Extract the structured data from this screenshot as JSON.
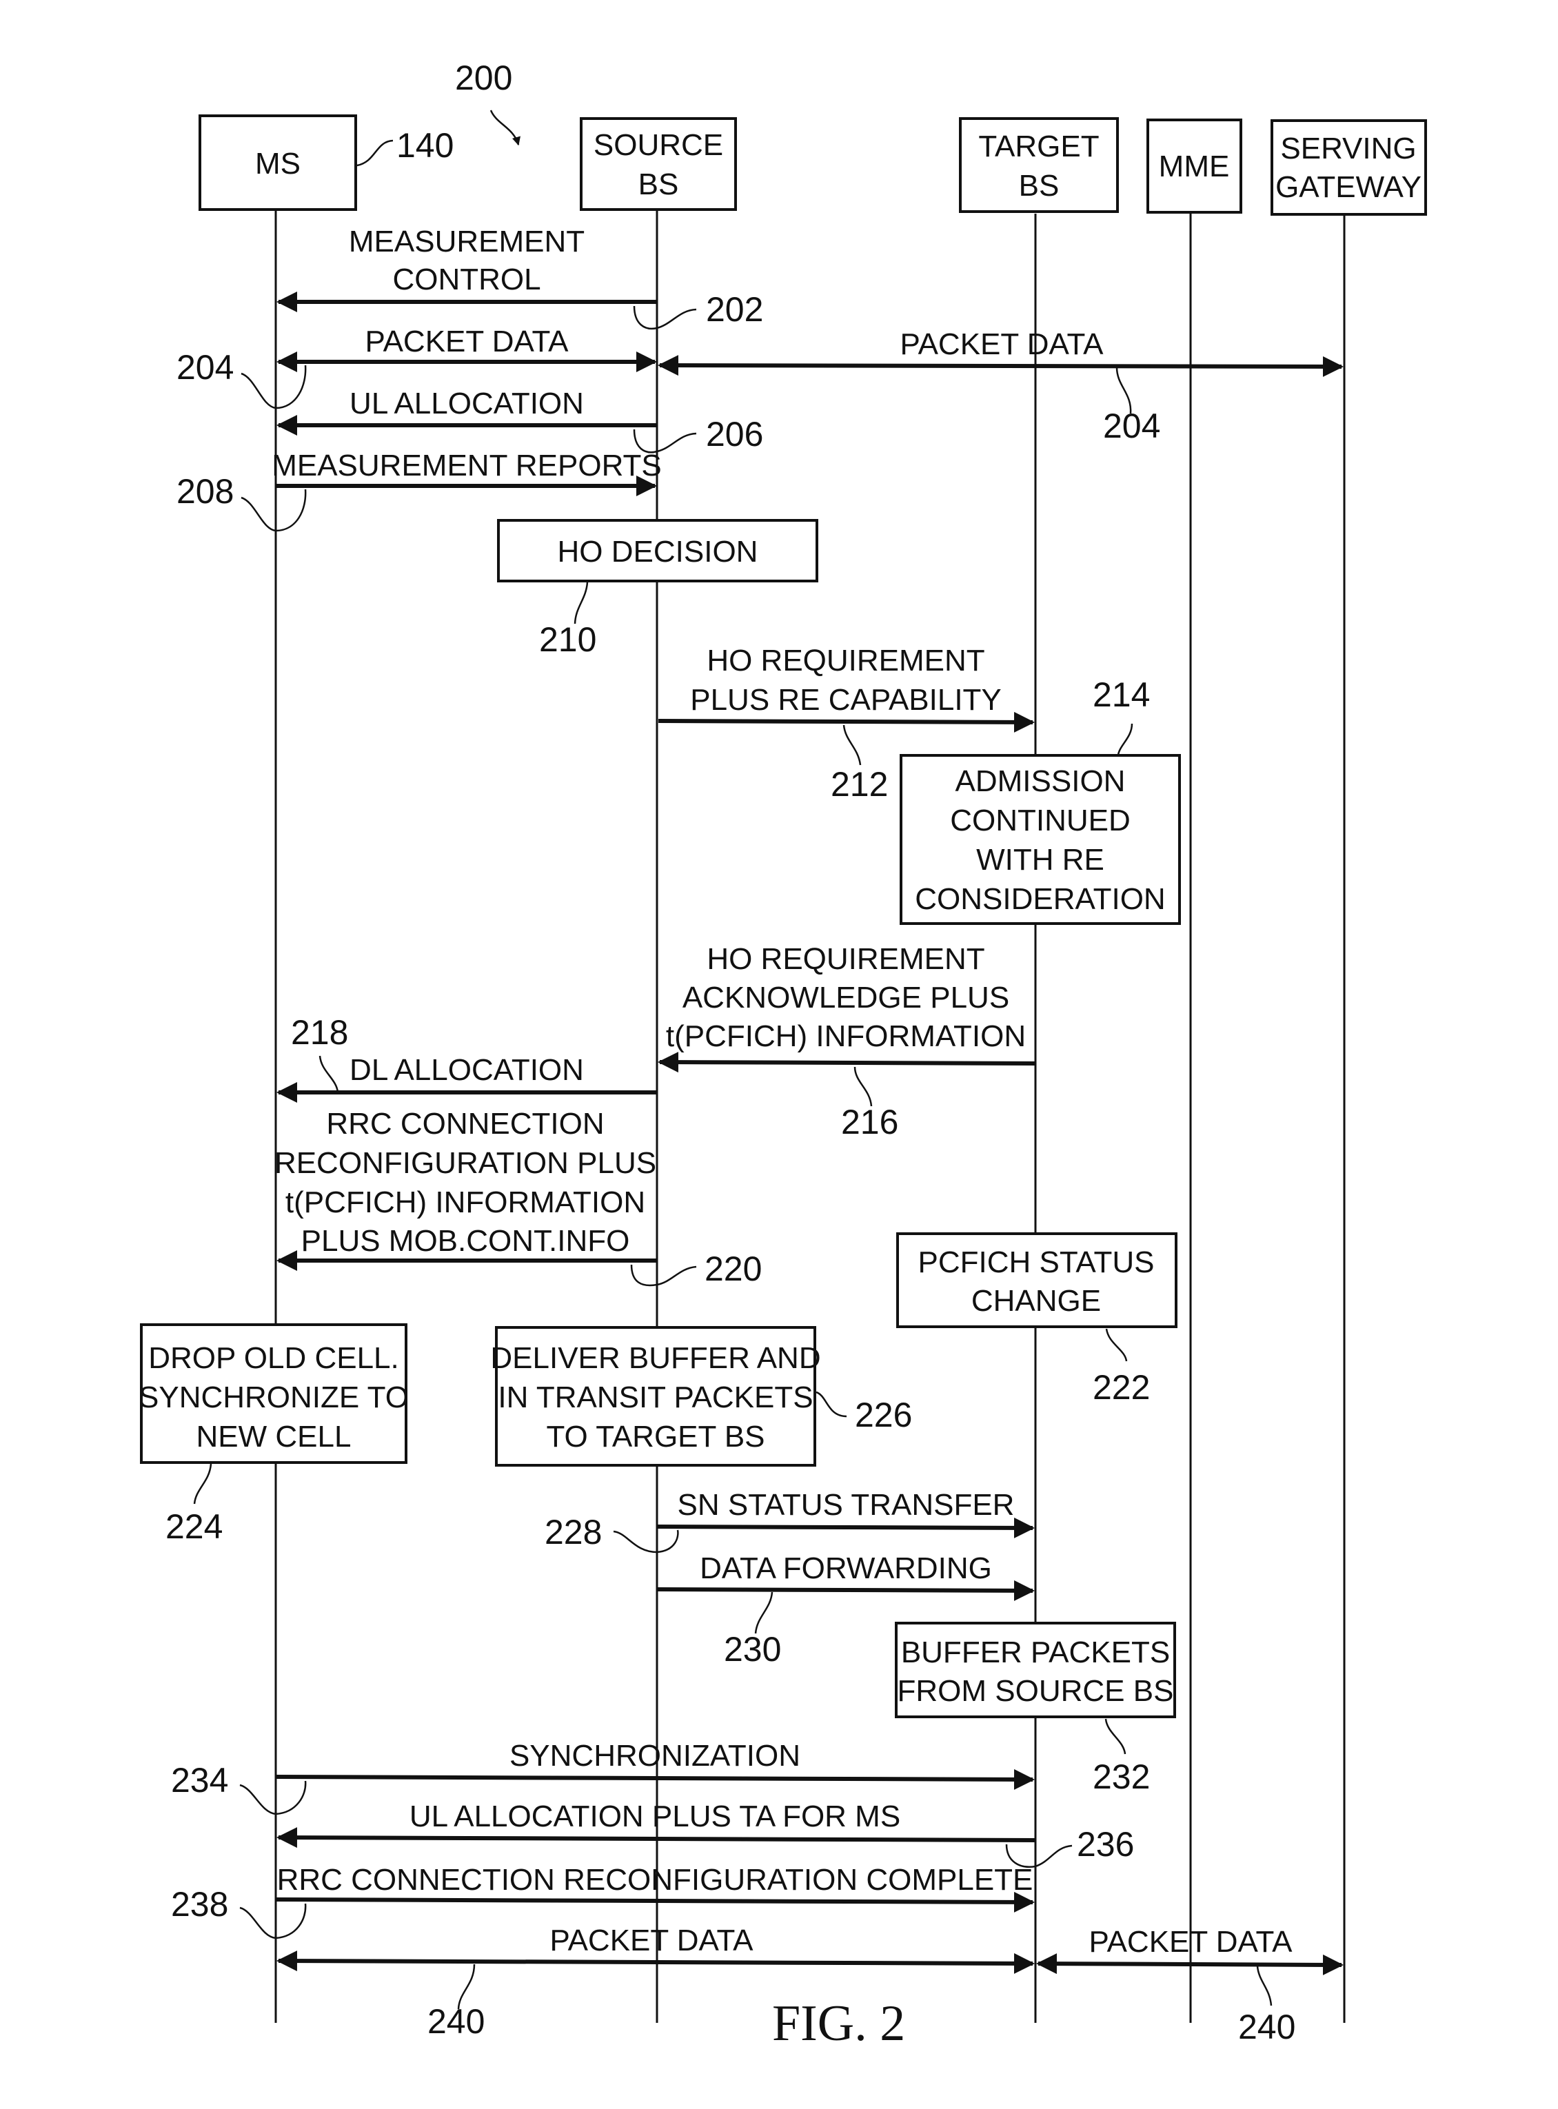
{
  "figure": {
    "ref": "200",
    "caption": "FIG. 2"
  },
  "entities": [
    {
      "id": "ms",
      "lines": [
        "MS"
      ],
      "ref": "140"
    },
    {
      "id": "source",
      "lines": [
        "SOURCE",
        "BS"
      ]
    },
    {
      "id": "target",
      "lines": [
        "TARGET",
        "BS"
      ]
    },
    {
      "id": "mme",
      "lines": [
        "MME"
      ]
    },
    {
      "id": "gateway",
      "lines": [
        "SERVING",
        "GATEWAY"
      ]
    }
  ],
  "messages": [
    {
      "id": "m202",
      "from": "source",
      "to": "ms",
      "lines": [
        "MEASUREMENT",
        "CONTROL"
      ],
      "ref": "202"
    },
    {
      "id": "m204a",
      "from": "ms",
      "to": "source",
      "bidir": true,
      "lines": [
        "PACKET DATA"
      ],
      "ref": "204"
    },
    {
      "id": "m204b",
      "from": "source",
      "to": "gateway",
      "bidir": true,
      "lines": [
        "PACKET DATA"
      ],
      "ref": "204"
    },
    {
      "id": "m206",
      "from": "source",
      "to": "ms",
      "lines": [
        "UL ALLOCATION"
      ],
      "ref": "206"
    },
    {
      "id": "m208",
      "from": "ms",
      "to": "source",
      "lines": [
        "MEASUREMENT REPORTS"
      ],
      "ref": "208"
    },
    {
      "id": "m212",
      "from": "source",
      "to": "target",
      "lines": [
        "HO REQUIREMENT",
        "PLUS RE CAPABILITY"
      ],
      "ref": "212"
    },
    {
      "id": "m216",
      "from": "target",
      "to": "source",
      "lines": [
        "HO REQUIREMENT",
        "ACKNOWLEDGE PLUS",
        "t(PCFICH) INFORMATION"
      ],
      "ref": "216"
    },
    {
      "id": "m218",
      "from": "source",
      "to": "ms",
      "lines": [
        "DL ALLOCATION"
      ],
      "ref": "218"
    },
    {
      "id": "m220",
      "from": "source",
      "to": "ms",
      "lines": [
        "RRC CONNECTION",
        "RECONFIGURATION PLUS",
        "t(PCFICH) INFORMATION",
        "PLUS MOB.CONT.INFO"
      ],
      "ref": "220"
    },
    {
      "id": "m228",
      "from": "source",
      "to": "target",
      "lines": [
        "SN STATUS TRANSFER"
      ],
      "ref": "228"
    },
    {
      "id": "m230",
      "from": "source",
      "to": "target",
      "lines": [
        "DATA FORWARDING"
      ],
      "ref": "230"
    },
    {
      "id": "m234",
      "from": "ms",
      "to": "target",
      "lines": [
        "SYNCHRONIZATION"
      ],
      "ref": "234"
    },
    {
      "id": "m236",
      "from": "target",
      "to": "ms",
      "lines": [
        "UL ALLOCATION PLUS TA FOR MS"
      ],
      "ref": "236"
    },
    {
      "id": "m238",
      "from": "ms",
      "to": "target",
      "lines": [
        "RRC CONNECTION RECONFIGURATION COMPLETE"
      ],
      "ref": "238"
    },
    {
      "id": "m240a",
      "from": "ms",
      "to": "target",
      "bidir": true,
      "lines": [
        "PACKET DATA"
      ],
      "ref": "240"
    },
    {
      "id": "m240b",
      "from": "target",
      "to": "gateway",
      "bidir": true,
      "lines": [
        "PACKET DATA"
      ],
      "ref": "240"
    }
  ],
  "actions": [
    {
      "id": "a210",
      "lines": [
        "HO DECISION"
      ],
      "ref": "210"
    },
    {
      "id": "a214",
      "lines": [
        "ADMISSION",
        "CONTINUED",
        "WITH RE",
        "CONSIDERATION"
      ],
      "ref": "214"
    },
    {
      "id": "a222",
      "lines": [
        "PCFICH STATUS",
        "CHANGE"
      ],
      "ref": "222"
    },
    {
      "id": "a224",
      "lines": [
        "DROP OLD CELL.",
        "SYNCHRONIZE TO",
        "NEW CELL"
      ],
      "ref": "224"
    },
    {
      "id": "a226",
      "lines": [
        "DELIVER BUFFER AND",
        "IN TRANSIT PACKETS",
        "TO TARGET BS"
      ],
      "ref": "226"
    },
    {
      "id": "a232",
      "lines": [
        "BUFFER PACKETS",
        "FROM SOURCE BS"
      ],
      "ref": "232"
    }
  ]
}
